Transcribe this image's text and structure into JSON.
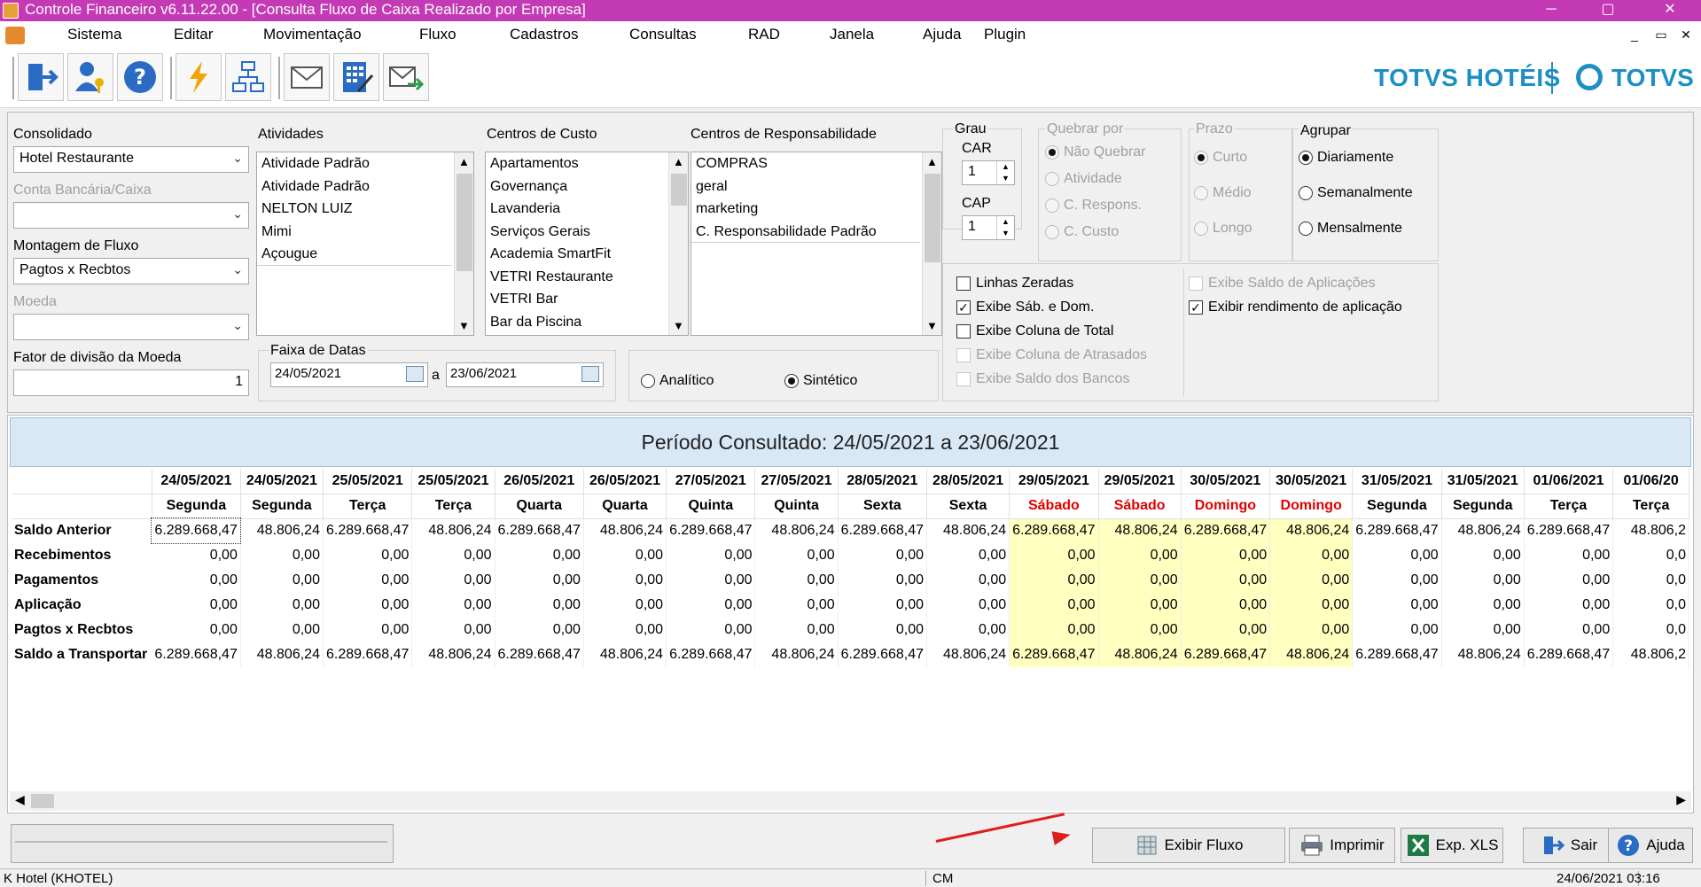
{
  "window": {
    "title": "Controle Financeiro v6.11.22.00 - [Consulta Fluxo de Caixa Realizado por Empresa]",
    "minimize": "─",
    "maximize": "▢",
    "close": "✕"
  },
  "menu": {
    "items": [
      "Sistema",
      "Editar",
      "Movimentação",
      "Fluxo",
      "Cadastros",
      "Consultas",
      "RAD",
      "Janela",
      "Ajuda",
      "Plugin"
    ],
    "mdi_minimize": "_",
    "mdi_restore": "▭",
    "mdi_close": "✕"
  },
  "brand": {
    "primary": "TOTVS HOTÉIS",
    "secondary": "TOTVS",
    "color": "#1d8fc4"
  },
  "filters": {
    "consolidado": {
      "label": "Consolidado",
      "value": "Hotel Restaurante"
    },
    "conta": {
      "label": "Conta Bancária/Caixa",
      "value": ""
    },
    "montagem": {
      "label": "Montagem de Fluxo",
      "value": "Pagtos x Recbtos"
    },
    "moeda": {
      "label": "Moeda",
      "value": ""
    },
    "fator": {
      "label": "Fator de divisão da Moeda",
      "value": "1"
    },
    "atividades": {
      "label": "Atividades",
      "items": [
        "Atividade Padrão",
        "Atividade Padrão",
        "NELTON LUIZ",
        "Mimi",
        "Açougue"
      ]
    },
    "centros_custo": {
      "label": "Centros de Custo",
      "items": [
        "Apartamentos",
        "Governança",
        "Lavanderia",
        "Serviços Gerais",
        "Academia SmartFit",
        "VETRI Restaurante",
        "VETRI Bar",
        "Bar da Piscina"
      ]
    },
    "centros_resp": {
      "label": "Centros de Responsabilidade",
      "items": [
        "COMPRAS",
        "geral",
        "marketing",
        "C. Responsabilidade Padrão"
      ]
    },
    "faixa": {
      "label": "Faixa de Datas",
      "from": "24/05/2021",
      "sep": "a",
      "to": "23/06/2021"
    },
    "modo": {
      "analitico": "Analítico",
      "sintetico": "Sintético"
    },
    "grau": {
      "label": "Grau",
      "car_label": "CAR",
      "car_value": "1",
      "cap_label": "CAP",
      "cap_value": "1"
    },
    "quebrar": {
      "label": "Quebrar por",
      "options": [
        "Não Quebrar",
        "Atividade",
        "C. Respons.",
        "C. Custo"
      ]
    },
    "prazo": {
      "label": "Prazo",
      "options": [
        "Curto",
        "Médio",
        "Longo"
      ]
    },
    "agrupar": {
      "label": "Agrupar",
      "options": [
        "Diariamente",
        "Semanalmente",
        "Mensalmente"
      ]
    },
    "checks_left": [
      {
        "label": "Linhas Zeradas",
        "checked": false,
        "enabled": true
      },
      {
        "label": "Exibe Sáb. e Dom.",
        "checked": true,
        "enabled": true
      },
      {
        "label": "Exibe Coluna de Total",
        "checked": false,
        "enabled": true
      },
      {
        "label": "Exibe Coluna de Atrasados",
        "checked": false,
        "enabled": false
      },
      {
        "label": "Exibe Saldo dos Bancos",
        "checked": false,
        "enabled": false
      }
    ],
    "checks_right": [
      {
        "label": "Exibe Saldo de Aplicações",
        "checked": false,
        "enabled": false
      },
      {
        "label": "Exibir rendimento de aplicação",
        "checked": true,
        "enabled": true
      }
    ]
  },
  "period": "Período Consultado: 24/05/2021 a 23/06/2021",
  "grid": {
    "dates": [
      "24/05/2021",
      "24/05/2021",
      "25/05/2021",
      "25/05/2021",
      "26/05/2021",
      "26/05/2021",
      "27/05/2021",
      "27/05/2021",
      "28/05/2021",
      "28/05/2021",
      "29/05/2021",
      "29/05/2021",
      "30/05/2021",
      "30/05/2021",
      "31/05/2021",
      "31/05/2021",
      "01/06/2021",
      "01/06/20"
    ],
    "days": [
      "Segunda",
      "Segunda",
      "Terça",
      "Terça",
      "Quarta",
      "Quarta",
      "Quinta",
      "Quinta",
      "Sexta",
      "Sexta",
      "Sábado",
      "Sábado",
      "Domingo",
      "Domingo",
      "Segunda",
      "Segunda",
      "Terça",
      "Terça"
    ],
    "weekend_color": "#ffffc0",
    "weekend_text_color": "#e00000",
    "rows": [
      {
        "label": "Saldo Anterior",
        "values": [
          "6.289.668,47",
          "48.806,24",
          "6.289.668,47",
          "48.806,24",
          "6.289.668,47",
          "48.806,24",
          "6.289.668,47",
          "48.806,24",
          "6.289.668,47",
          "48.806,24",
          "6.289.668,47",
          "48.806,24",
          "6.289.668,47",
          "48.806,24",
          "6.289.668,47",
          "48.806,24",
          "6.289.668,47",
          "48.806,2"
        ]
      },
      {
        "label": "Recebimentos",
        "values": [
          "0,00",
          "0,00",
          "0,00",
          "0,00",
          "0,00",
          "0,00",
          "0,00",
          "0,00",
          "0,00",
          "0,00",
          "0,00",
          "0,00",
          "0,00",
          "0,00",
          "0,00",
          "0,00",
          "0,00",
          "0,0"
        ]
      },
      {
        "label": "Pagamentos",
        "values": [
          "0,00",
          "0,00",
          "0,00",
          "0,00",
          "0,00",
          "0,00",
          "0,00",
          "0,00",
          "0,00",
          "0,00",
          "0,00",
          "0,00",
          "0,00",
          "0,00",
          "0,00",
          "0,00",
          "0,00",
          "0,0"
        ]
      },
      {
        "label": "Aplicação",
        "values": [
          "0,00",
          "0,00",
          "0,00",
          "0,00",
          "0,00",
          "0,00",
          "0,00",
          "0,00",
          "0,00",
          "0,00",
          "0,00",
          "0,00",
          "0,00",
          "0,00",
          "0,00",
          "0,00",
          "0,00",
          "0,0"
        ]
      },
      {
        "label": "Pagtos x Recbtos",
        "values": [
          "0,00",
          "0,00",
          "0,00",
          "0,00",
          "0,00",
          "0,00",
          "0,00",
          "0,00",
          "0,00",
          "0,00",
          "0,00",
          "0,00",
          "0,00",
          "0,00",
          "0,00",
          "0,00",
          "0,00",
          "0,0"
        ]
      },
      {
        "label": "Saldo a Transportar",
        "values": [
          "6.289.668,47",
          "48.806,24",
          "6.289.668,47",
          "48.806,24",
          "6.289.668,47",
          "48.806,24",
          "6.289.668,47",
          "48.806,24",
          "6.289.668,47",
          "48.806,24",
          "6.289.668,47",
          "48.806,24",
          "6.289.668,47",
          "48.806,24",
          "6.289.668,47",
          "48.806,24",
          "6.289.668,47",
          "48.806,2"
        ]
      }
    ]
  },
  "buttons": {
    "exibir": "Exibir Fluxo",
    "imprimir": "Imprimir",
    "exp": "Exp. XLS",
    "sair": "Sair",
    "ajuda": "Ajuda"
  },
  "status": {
    "hotel": "K Hotel (KHOTEL)",
    "user": "CM",
    "datetime": "24/06/2021 03:16"
  }
}
